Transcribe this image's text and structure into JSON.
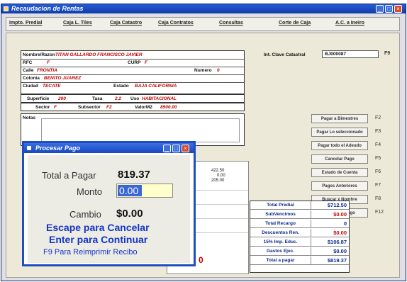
{
  "window": {
    "title": "Recaudacion de Rentas"
  },
  "tabs": [
    "Impto. Predial",
    "Caja L. Tiles",
    "Caja Catastro",
    "Caja Contratos",
    "Consultas",
    "Corte de Caja",
    "A.C. a Ineiro"
  ],
  "form": {
    "nombre_label": "Nombre/Razon",
    "nombre_value": "TITAN GALLARDO FRANCISCO JAVIER",
    "rfc_label": "RFC",
    "rfc_value": "F",
    "curp_label": "CURP",
    "curp_value": "F",
    "calle_label": "Calle",
    "calle_value": "FRONTIA",
    "numero_label": "Numero",
    "numero_value": "0",
    "colonia_label": "Colonia",
    "colonia_value": "BENITO JUAREZ",
    "ciudad_label": "Ciudad",
    "ciudad_value": "TECATE",
    "estado_label": "Estado",
    "estado_value": "BAJA CALIFORNIA",
    "superficie_label": "Superficie",
    "superficie_value": "200",
    "tasa_label": "Tasa",
    "tasa_value": "2.2",
    "uso_label": "Uso",
    "uso_value": "HABITACIONAL",
    "sector_label": "Sector",
    "sector_value": "F",
    "subsector_label": "Subsector",
    "subsector_value": "F2",
    "valor_label": "ValorM2",
    "valor_value": "8500.00",
    "notas_label": "Notas"
  },
  "clave": {
    "label": "Int. Clave Catastral",
    "value": "BJ000087",
    "fkey": "F9"
  },
  "actions": [
    {
      "label": "Pagar a Bimestres",
      "key": "F2"
    },
    {
      "label": "Pagar Lo seleccionado",
      "key": "F3"
    },
    {
      "label": "Pagar todo el Adeudo",
      "key": "F4"
    },
    {
      "label": "Cancelar Pago",
      "key": "F5"
    },
    {
      "label": "Estado de Cuenta",
      "key": "F6"
    },
    {
      "label": "Pagos Anteriores",
      "key": "F7"
    },
    {
      "label": "Buscar x Nombre",
      "key": "F8"
    },
    {
      "label": "Checkout Pago",
      "key": "F12"
    }
  ],
  "list_values": [
    "422.50",
    "0.00",
    "205.00"
  ],
  "totals": [
    {
      "label": "Total Predial",
      "value": "$712.50",
      "color": "#0b2a8a"
    },
    {
      "label": "SubVencimos",
      "value": "$0.00",
      "color": "#cc0000"
    },
    {
      "label": "Total Recargo",
      "value": "0",
      "color": "#0b2a8a"
    },
    {
      "label": "Descuentos Ren.",
      "value": "$0.00",
      "color": "#cc0000"
    },
    {
      "label": "15% Imp. Educ.",
      "value": "$106.87",
      "color": "#0b2a8a"
    },
    {
      "label": "Gastos Ejec.",
      "value": "$0.00",
      "color": "#0b2a8a"
    },
    {
      "label": "Total a pagar",
      "value": "$819.37",
      "color": "#0b2a8a"
    }
  ],
  "dialog": {
    "title": "Procesar Pago",
    "total_label": "Total a Pagar",
    "total_value": "819.37",
    "monto_label": "Monto",
    "monto_value": "0.00",
    "cambio_label": "Cambio",
    "cambio_value": "$0.00",
    "escape_text": "Escape para Cancelar",
    "enter_text": "Enter para Continuar",
    "f9_text": "F9 Para Reimprimir Recibo"
  },
  "stray_char": "0"
}
